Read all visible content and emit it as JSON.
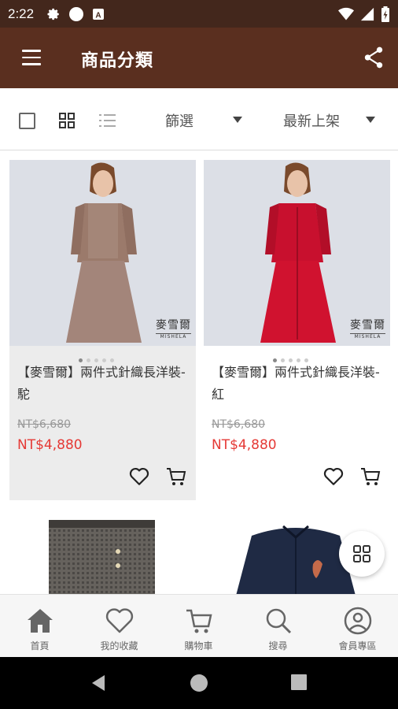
{
  "status_bar": {
    "time": "2:22"
  },
  "app_bar": {
    "title": "商品分類"
  },
  "toolbar": {
    "filter_label": "篩選",
    "sort_label": "最新上架"
  },
  "products": [
    {
      "name": "【麥雪爾】兩件式針織長洋裝-駝",
      "old_price": "NT$6,680",
      "new_price": "NT$4,880",
      "brand": "麥雪爾",
      "brand_sub": "MISHELA"
    },
    {
      "name": "【麥雪爾】兩件式針織長洋裝-紅",
      "old_price": "NT$6,680",
      "new_price": "NT$4,880",
      "brand": "麥雪爾",
      "brand_sub": "MISHELA"
    }
  ],
  "bottom_nav": [
    {
      "label": "首頁",
      "icon": "home-icon"
    },
    {
      "label": "我的收藏",
      "icon": "heart-icon"
    },
    {
      "label": "購物車",
      "icon": "cart-icon"
    },
    {
      "label": "搜尋",
      "icon": "search-icon"
    },
    {
      "label": "會員專區",
      "icon": "account-icon"
    }
  ],
  "colors": {
    "status_bar": "#43271c",
    "app_bar": "#5a2f1f",
    "price": "#e53935"
  }
}
